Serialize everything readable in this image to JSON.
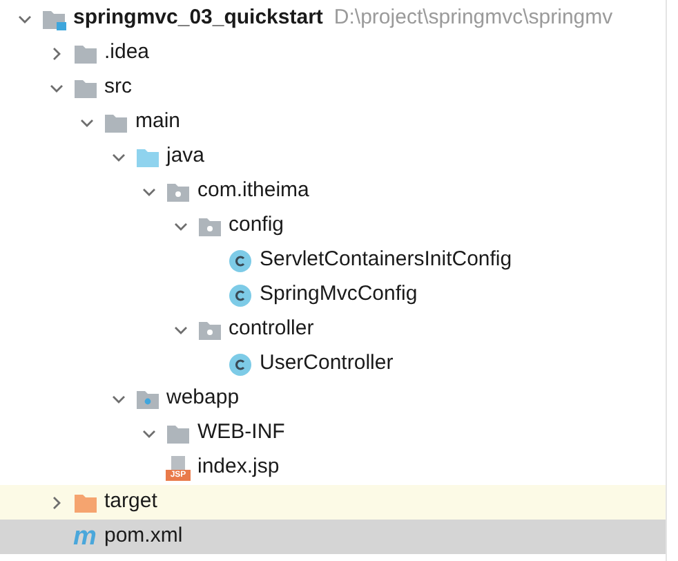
{
  "tree": [
    {
      "name": "springmvc_03_quickstart",
      "path": "D:\\project\\springmvc\\springmv",
      "kind": "module",
      "expanded": true,
      "selected": false,
      "children": [
        {
          "name": ".idea",
          "kind": "folder",
          "expanded": false,
          "selected": false
        },
        {
          "name": "src",
          "kind": "folder",
          "expanded": true,
          "selected": false,
          "children": [
            {
              "name": "main",
              "kind": "folder",
              "expanded": true,
              "selected": false,
              "children": [
                {
                  "name": "java",
                  "kind": "source-folder",
                  "expanded": true,
                  "selected": false,
                  "children": [
                    {
                      "name": "com.itheima",
                      "kind": "package",
                      "expanded": true,
                      "selected": false,
                      "children": [
                        {
                          "name": "config",
                          "kind": "package",
                          "expanded": true,
                          "selected": false,
                          "children": [
                            {
                              "name": "ServletContainersInitConfig",
                              "kind": "class",
                              "selected": false
                            },
                            {
                              "name": "SpringMvcConfig",
                              "kind": "class",
                              "selected": false
                            }
                          ]
                        },
                        {
                          "name": "controller",
                          "kind": "package",
                          "expanded": true,
                          "selected": false,
                          "children": [
                            {
                              "name": "UserController",
                              "kind": "class",
                              "selected": false
                            }
                          ]
                        }
                      ]
                    }
                  ]
                },
                {
                  "name": "webapp",
                  "kind": "web-folder",
                  "expanded": true,
                  "selected": false,
                  "children": [
                    {
                      "name": "WEB-INF",
                      "kind": "folder",
                      "expanded": true,
                      "selected": false
                    },
                    {
                      "name": "index.jsp",
                      "kind": "jsp",
                      "badge": "JSP",
                      "selected": false
                    }
                  ]
                }
              ]
            }
          ]
        },
        {
          "name": "target",
          "kind": "excluded-folder",
          "expanded": false,
          "selected": false
        },
        {
          "name": "pom.xml",
          "kind": "maven",
          "badge": "m",
          "selected": true
        }
      ]
    }
  ]
}
